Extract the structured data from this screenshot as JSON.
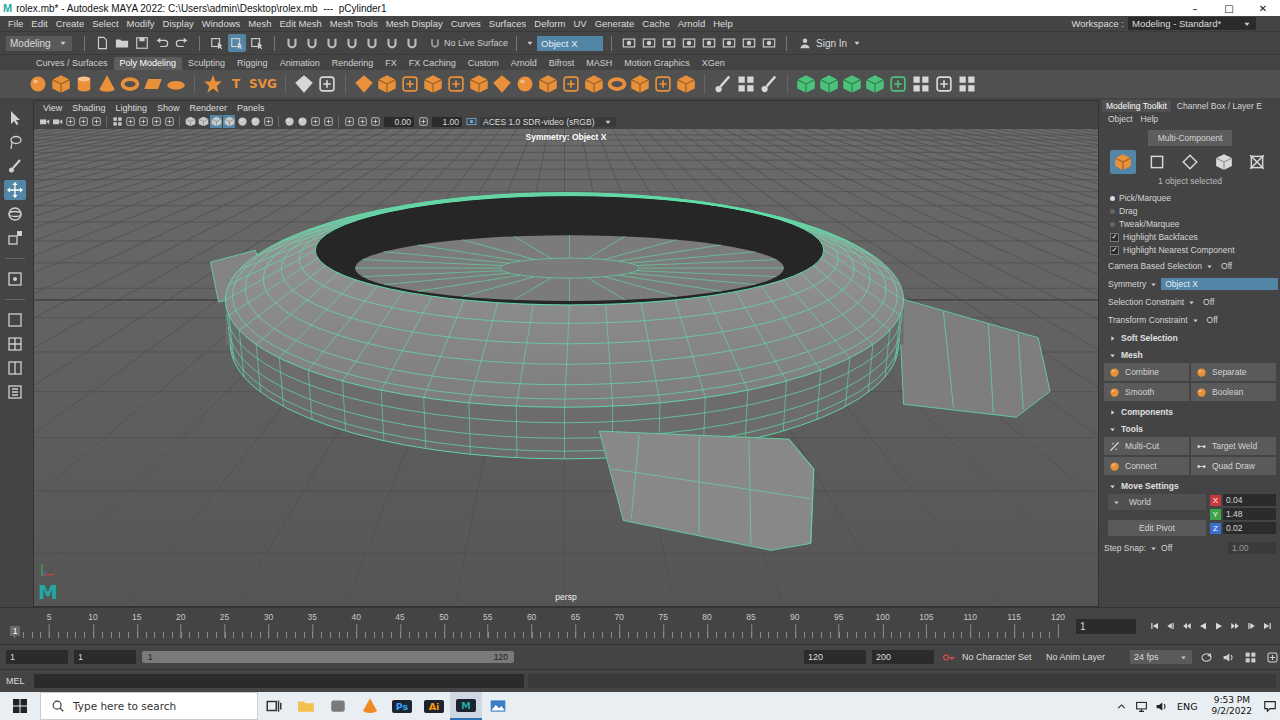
{
  "window": {
    "logo": "M",
    "title": "rolex.mb* - Autodesk MAYA 2022: C:\\Users\\admin\\Desktop\\rolex.mb  ---  pCylinder1",
    "controls": [
      "–",
      "□",
      "✕"
    ]
  },
  "menu": [
    "File",
    "Edit",
    "Create",
    "Select",
    "Modify",
    "Display",
    "Windows",
    "Mesh",
    "Edit Mesh",
    "Mesh Tools",
    "Mesh Display",
    "Curves",
    "Surfaces",
    "Deform",
    "UV",
    "Generate",
    "Cache",
    "Arnold",
    "Help"
  ],
  "workspace": {
    "label": "Workspace :",
    "value": "Modeling - Standard*"
  },
  "status_line": {
    "mode": "Modeling",
    "file_icons": [
      "doc",
      "folder",
      "save",
      "undo",
      "redo"
    ],
    "mask_icons": [
      {
        "kind": "mask",
        "selected": false
      },
      {
        "kind": "mask",
        "selected": true
      },
      {
        "kind": "mask",
        "selected": false
      }
    ],
    "snap_icons": [
      "magnet",
      "magnet",
      "magnet",
      "magnet",
      "magnet",
      "magnet",
      "magnet"
    ],
    "live_surface": "No Live Surface",
    "symmetry": "Object X",
    "render_icons": [
      "render",
      "render",
      "render",
      "render",
      "render",
      "render",
      "render",
      "render"
    ],
    "sign_in": "Sign In"
  },
  "shelf": {
    "tabs": [
      {
        "label": "Curves / Surfaces",
        "selected": false
      },
      {
        "label": "Poly Modeling",
        "selected": true
      },
      {
        "label": "Sculpting",
        "selected": false
      },
      {
        "label": "Rigging",
        "selected": false
      },
      {
        "label": "Animation",
        "selected": false
      },
      {
        "label": "Rendering",
        "selected": false
      },
      {
        "label": "FX",
        "selected": false
      },
      {
        "label": "FX Caching",
        "selected": false
      },
      {
        "label": "Custom",
        "selected": false
      },
      {
        "label": "Arnold",
        "selected": false
      },
      {
        "label": "Bifrost",
        "selected": false
      },
      {
        "label": "MASH",
        "selected": false
      },
      {
        "label": "Motion Graphics",
        "selected": false
      },
      {
        "label": "XGen",
        "selected": false
      }
    ],
    "icons": [
      {
        "kind": "sphere",
        "label": "",
        "color": "#e8913a"
      },
      {
        "kind": "cube",
        "label": "",
        "color": "#e8913a"
      },
      {
        "kind": "cylinder",
        "label": "",
        "color": "#e8913a"
      },
      {
        "kind": "cone",
        "label": "",
        "color": "#e8913a"
      },
      {
        "kind": "torus",
        "label": "",
        "color": "#e8913a"
      },
      {
        "kind": "plane",
        "label": "",
        "color": "#e8913a"
      },
      {
        "kind": "disc",
        "label": "",
        "color": "#e8913a"
      },
      {
        "kind": "sep",
        "label": "",
        "color": "#666666"
      },
      {
        "kind": "star",
        "label": "",
        "color": "#e8913a"
      },
      {
        "kind": "text",
        "label": "T",
        "color": "#e8913a"
      },
      {
        "kind": "text",
        "label": "SVG",
        "color": "#e8913a"
      },
      {
        "kind": "sep",
        "label": "",
        "color": "#666666"
      },
      {
        "kind": "gem",
        "label": "",
        "color": "#d8d8d8"
      },
      {
        "kind": "tool",
        "label": "",
        "color": "#d8d8d8"
      },
      {
        "kind": "sep",
        "label": "",
        "color": "#666666"
      },
      {
        "kind": "gem",
        "label": "",
        "color": "#e8913a"
      },
      {
        "kind": "cube",
        "label": "",
        "color": "#e8913a"
      },
      {
        "kind": "tool",
        "label": "",
        "color": "#e8913a"
      },
      {
        "kind": "cube",
        "label": "",
        "color": "#e8913a"
      },
      {
        "kind": "tool",
        "label": "",
        "color": "#e8913a"
      },
      {
        "kind": "cube",
        "label": "",
        "color": "#e8913a"
      },
      {
        "kind": "gem",
        "label": "",
        "color": "#e8913a"
      },
      {
        "kind": "sphere",
        "label": "",
        "color": "#e8913a"
      },
      {
        "kind": "cube",
        "label": "",
        "color": "#e8913a"
      },
      {
        "kind": "tool",
        "label": "",
        "color": "#e8913a"
      },
      {
        "kind": "cube",
        "label": "",
        "color": "#e8913a"
      },
      {
        "kind": "torus",
        "label": "",
        "color": "#e8913a"
      },
      {
        "kind": "cube",
        "label": "",
        "color": "#e8913a"
      },
      {
        "kind": "tool",
        "label": "",
        "color": "#e8913a"
      },
      {
        "kind": "cube",
        "label": "",
        "color": "#e8913a"
      },
      {
        "kind": "sep",
        "label": "",
        "color": "#666666"
      },
      {
        "kind": "brush",
        "label": "",
        "color": "#d8d8d8"
      },
      {
        "kind": "grid",
        "label": "",
        "color": "#d8d8d8"
      },
      {
        "kind": "brush",
        "label": "",
        "color": "#d8d8d8"
      },
      {
        "kind": "sep",
        "label": "",
        "color": "#666666"
      },
      {
        "kind": "cube",
        "label": "",
        "color": "#4cc27a"
      },
      {
        "kind": "cube",
        "label": "",
        "color": "#4cc27a"
      },
      {
        "kind": "cube",
        "label": "",
        "color": "#4cc27a"
      },
      {
        "kind": "cube",
        "label": "",
        "color": "#4cc27a"
      },
      {
        "kind": "tool",
        "label": "",
        "color": "#4cc27a"
      },
      {
        "kind": "grid",
        "label": "",
        "color": "#d8d8d8"
      },
      {
        "kind": "tool",
        "label": "",
        "color": "#d8d8d8"
      },
      {
        "kind": "grid",
        "label": "",
        "color": "#d8d8d8"
      }
    ]
  },
  "toolbox": [
    {
      "kind": "arrow",
      "selected": false
    },
    {
      "kind": "lasso",
      "selected": false
    },
    {
      "kind": "brush",
      "selected": false
    },
    {
      "kind": "move",
      "selected": true
    },
    {
      "kind": "rotate",
      "selected": false
    },
    {
      "kind": "scale",
      "selected": false
    },
    {
      "kind": "sep",
      "selected": false
    },
    {
      "kind": "manip",
      "selected": false
    },
    {
      "kind": "sep",
      "selected": false
    },
    {
      "kind": "layout-single",
      "selected": false
    },
    {
      "kind": "layout-four",
      "selected": false
    },
    {
      "kind": "layout-two",
      "selected": false
    },
    {
      "kind": "outliner",
      "selected": false
    }
  ],
  "viewport": {
    "menus": [
      "View",
      "Shading",
      "Lighting",
      "Show",
      "Renderer",
      "Panels"
    ],
    "tools": [
      {
        "kind": "camera",
        "selected": false
      },
      {
        "kind": "camera",
        "selected": false
      },
      {
        "kind": "tool",
        "selected": false
      },
      {
        "kind": "tool",
        "selected": false
      },
      {
        "kind": "tool",
        "selected": false
      },
      {
        "kind": "sep",
        "selected": false
      },
      {
        "kind": "grid",
        "selected": false
      },
      {
        "kind": "tool",
        "selected": false
      },
      {
        "kind": "tool",
        "selected": false
      },
      {
        "kind": "tool",
        "selected": false
      },
      {
        "kind": "tool",
        "selected": false
      },
      {
        "kind": "sep",
        "selected": false
      },
      {
        "kind": "cube",
        "selected": false
      },
      {
        "kind": "cube",
        "selected": false
      },
      {
        "kind": "cube",
        "selected": true
      },
      {
        "kind": "cube",
        "selected": true
      },
      {
        "kind": "sphere",
        "selected": false
      },
      {
        "kind": "sphere",
        "selected": false
      },
      {
        "kind": "tool",
        "selected": false
      },
      {
        "kind": "sep",
        "selected": false
      },
      {
        "kind": "sphere",
        "selected": false
      },
      {
        "kind": "sphere",
        "selected": false
      },
      {
        "kind": "tool",
        "selected": false
      },
      {
        "kind": "tool",
        "selected": false
      },
      {
        "kind": "sep",
        "selected": false
      },
      {
        "kind": "tool",
        "selected": false
      },
      {
        "kind": "tool",
        "selected": false
      },
      {
        "kind": "tool",
        "selected": false
      }
    ],
    "exposure": "0.00",
    "gamma": "1.00",
    "color_space": "ACES 1.0 SDR-video (sRGB)",
    "heading": "Symmetry: Object X",
    "camera": "persp",
    "logo": "M"
  },
  "toolkit": {
    "tabs": [
      {
        "label": "Modeling Toolkit",
        "selected": true
      },
      {
        "label": "Channel Box / Layer E",
        "selected": false
      }
    ],
    "menus": [
      "Object",
      "Help"
    ],
    "mode_button": "Multi-Component",
    "components": [
      {
        "kind": "cube",
        "selected": true
      },
      {
        "kind": "square",
        "selected": false
      },
      {
        "kind": "diamond",
        "selected": false
      },
      {
        "kind": "cube",
        "selected": false
      },
      {
        "kind": "uv",
        "selected": false
      }
    ],
    "selection_count": "1 object selected",
    "pick_modes": [
      {
        "label": "Pick/Marquee",
        "selected": true
      },
      {
        "label": "Drag",
        "selected": false
      },
      {
        "label": "Tweak/Marquee",
        "selected": false
      }
    ],
    "options": [
      {
        "label": "Highlight Backfaces",
        "checked": true
      },
      {
        "label": "Highlight Nearest Component",
        "checked": true
      }
    ],
    "settings": [
      {
        "label": "Camera Based Selection",
        "value": "Off",
        "highlighted": false
      },
      {
        "label": "Symmetry",
        "value": "Object X",
        "highlighted": true
      },
      {
        "label": "Selection Constraint",
        "value": "Off",
        "highlighted": false
      },
      {
        "label": "Transform Constraint",
        "value": "Off",
        "highlighted": false
      }
    ],
    "soft_selection": {
      "title": "Soft Selection",
      "expanded": false
    },
    "mesh": {
      "title": "Mesh",
      "expanded": true,
      "buttons": [
        {
          "label": "Combine",
          "kind": "sphere"
        },
        {
          "label": "Separate",
          "kind": "sphere"
        },
        {
          "label": "Smooth",
          "kind": "sphere"
        },
        {
          "label": "Boolean",
          "kind": "sphere"
        }
      ]
    },
    "components_section": {
      "title": "Components",
      "expanded": false
    },
    "tools": {
      "title": "Tools",
      "expanded": true,
      "buttons": [
        {
          "label": "Multi-Cut",
          "kind": "knife"
        },
        {
          "label": "Target Weld",
          "kind": "weld"
        },
        {
          "label": "Connect",
          "kind": "sphere"
        },
        {
          "label": "Quad Draw",
          "kind": "weld"
        }
      ]
    },
    "move_settings": {
      "title": "Move Settings",
      "expanded": true,
      "space": "World",
      "axes": [
        {
          "axis": "X",
          "value": "0.04",
          "color": "#c8383c"
        },
        {
          "axis": "Y",
          "value": "1.48",
          "color": "#3fa34a"
        },
        {
          "axis": "Z",
          "value": "0.02",
          "color": "#3b6fd1"
        }
      ],
      "edit_pivot": "Edit Pivot",
      "step_snap": {
        "label": "Step Snap:",
        "value": "Off",
        "amount": "1.00"
      }
    }
  },
  "timeline": {
    "ticks": [
      "5",
      "10",
      "15",
      "20",
      "25",
      "30",
      "35",
      "40",
      "45",
      "50",
      "55",
      "60",
      "65",
      "70",
      "75",
      "80",
      "85",
      "90",
      "95",
      "100",
      "105",
      "110",
      "115",
      "120"
    ],
    "playhead": {
      "label": "1",
      "level": 0
    },
    "current": "1",
    "controls": [
      "to-start",
      "step-back",
      "key-back",
      "play-back",
      "play",
      "key-fwd",
      "step-fwd",
      "to-end"
    ]
  },
  "range": {
    "start": "1",
    "range_start": "1",
    "slider_start": "1",
    "slider_end": "120",
    "range_end": "120",
    "end": "200",
    "character_set": "No Character Set",
    "anim_layer": "No Anim Layer",
    "fps": "24 fps",
    "icons": [
      "loop",
      "speaker",
      "grid",
      "tool"
    ]
  },
  "command_line": {
    "language": "MEL"
  },
  "taskbar": {
    "search_placeholder": "Type here to search",
    "apps": [
      {
        "kind": "task-view",
        "label": "",
        "color": "#333333",
        "selected": false
      },
      {
        "kind": "folder",
        "label": "",
        "color": "#f2c14e",
        "selected": false
      },
      {
        "kind": "app",
        "label": "",
        "color": "#7a7a7a",
        "selected": false
      },
      {
        "kind": "cone",
        "label": "",
        "color": "#f08a24",
        "selected": false
      },
      {
        "kind": "text",
        "label": "Ps",
        "color": "#31a8ff",
        "selected": false
      },
      {
        "kind": "text",
        "label": "Ai",
        "color": "#ff9a00",
        "selected": false
      },
      {
        "kind": "text",
        "label": "M",
        "color": "#1fa9a2",
        "selected": true
      },
      {
        "kind": "photo",
        "label": "",
        "color": "#3b7fc4",
        "selected": false
      }
    ],
    "tray": [
      "chevron-up",
      "network",
      "speaker"
    ],
    "language": "ENG",
    "time": "9:53 PM",
    "date": "9/2/2022"
  }
}
